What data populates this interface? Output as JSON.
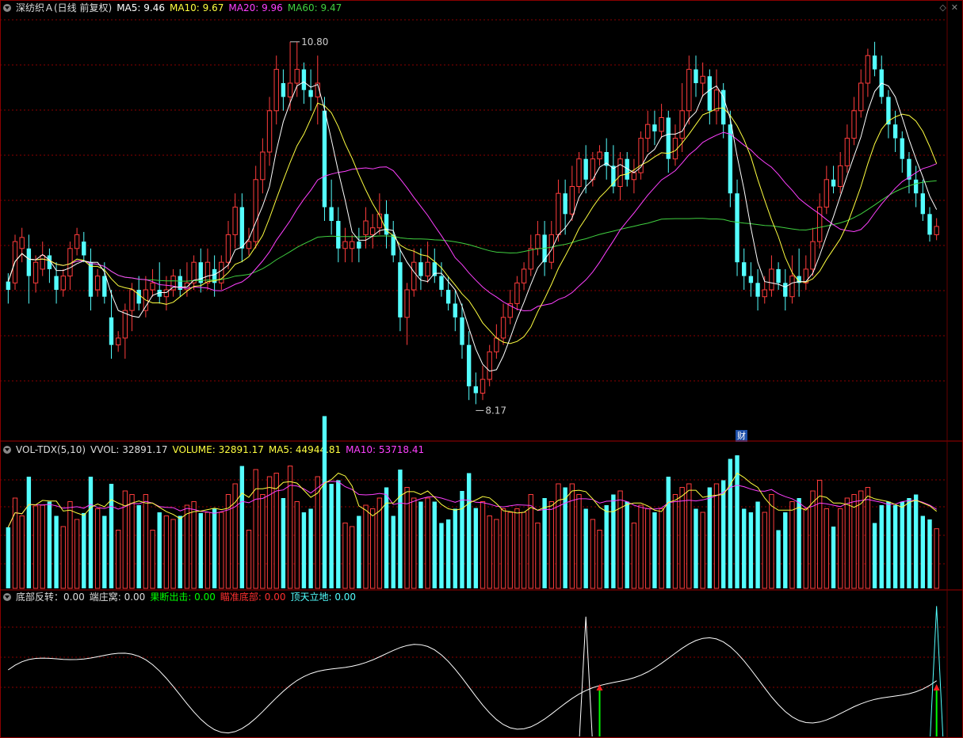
{
  "header_main": {
    "title": "深纺织Ａ(日线 前复权)",
    "ma5": "MA5: 9.46",
    "ma10": "MA10: 9.67",
    "ma20": "MA20: 9.96",
    "ma60": "MA60: 9.47"
  },
  "header_vol": {
    "name": "VOL-TDX(5,10)",
    "vvol": "VVOL: 32891.17",
    "volume": "VOLUME: 32891.17",
    "ma5": "MA5: 44944.81",
    "ma10": "MA10: 53718.41"
  },
  "header_ind": {
    "a": "底部反转：0.00",
    "b": "端庄窝: 0.00",
    "c": "果断出击: 0.00",
    "d": "瞄准底部: 0.00",
    "e": "顶天立地: 0.00"
  },
  "marker_high": "10.80",
  "marker_low": "8.17",
  "event_tag": "财",
  "colors": {
    "up": "#ff3c3c",
    "down": "#54ffff",
    "ma5": "#ffffff",
    "ma10": "#ffff40",
    "ma20": "#ff40ff",
    "ma60": "#40d040",
    "grid": "#8b0000",
    "green": "#00ff00",
    "red": "#ff2020"
  },
  "chart_data": {
    "type": "candlestick",
    "price_range": [
      8.0,
      11.0
    ],
    "volume_range": [
      0,
      110000
    ],
    "candles": [
      [
        9.0,
        9.06,
        9.12,
        8.9,
        "d"
      ],
      [
        9.05,
        9.35,
        9.4,
        9.0,
        "u"
      ],
      [
        9.3,
        9.38,
        9.45,
        9.2,
        "u"
      ],
      [
        9.3,
        9.1,
        9.4,
        8.9,
        "d"
      ],
      [
        9.05,
        9.2,
        9.25,
        8.98,
        "u"
      ],
      [
        9.15,
        9.25,
        9.35,
        9.1,
        "u"
      ],
      [
        9.25,
        9.15,
        9.3,
        9.05,
        "d"
      ],
      [
        9.1,
        9.0,
        9.2,
        8.9,
        "d"
      ],
      [
        9.0,
        9.1,
        9.15,
        8.95,
        "u"
      ],
      [
        9.1,
        9.3,
        9.35,
        9.0,
        "u"
      ],
      [
        9.3,
        9.4,
        9.45,
        9.25,
        "u"
      ],
      [
        9.35,
        9.25,
        9.42,
        9.2,
        "d"
      ],
      [
        9.2,
        8.95,
        9.3,
        8.85,
        "d"
      ],
      [
        9.0,
        9.1,
        9.15,
        8.95,
        "u"
      ],
      [
        9.1,
        8.95,
        9.2,
        8.9,
        "d"
      ],
      [
        8.8,
        8.6,
        9.0,
        8.5,
        "d"
      ],
      [
        8.6,
        8.65,
        8.7,
        8.55,
        "u"
      ],
      [
        8.65,
        8.85,
        8.9,
        8.5,
        "u"
      ],
      [
        8.85,
        9.0,
        9.05,
        8.7,
        "u"
      ],
      [
        9.0,
        8.9,
        9.1,
        8.85,
        "d"
      ],
      [
        8.85,
        9.0,
        9.1,
        8.8,
        "u"
      ],
      [
        9.0,
        9.05,
        9.15,
        8.95,
        "u"
      ],
      [
        9.0,
        8.95,
        9.2,
        8.9,
        "d"
      ],
      [
        8.95,
        9.0,
        9.1,
        8.85,
        "u"
      ],
      [
        9.0,
        9.1,
        9.15,
        8.95,
        "u"
      ],
      [
        9.1,
        9.0,
        9.15,
        8.95,
        "d"
      ],
      [
        9.0,
        9.05,
        9.2,
        8.95,
        "u"
      ],
      [
        9.05,
        9.2,
        9.25,
        9.0,
        "u"
      ],
      [
        9.2,
        9.05,
        9.3,
        8.98,
        "d"
      ],
      [
        9.05,
        9.2,
        9.3,
        9.0,
        "u"
      ],
      [
        9.15,
        9.05,
        9.25,
        8.95,
        "d"
      ],
      [
        9.05,
        9.2,
        9.25,
        9.0,
        "u"
      ],
      [
        9.2,
        9.4,
        9.5,
        9.15,
        "u"
      ],
      [
        9.4,
        9.6,
        9.7,
        9.3,
        "u"
      ],
      [
        9.6,
        9.3,
        9.7,
        9.2,
        "d"
      ],
      [
        9.3,
        9.35,
        9.45,
        9.25,
        "u"
      ],
      [
        9.35,
        9.8,
        9.9,
        9.3,
        "u"
      ],
      [
        9.8,
        10.0,
        10.1,
        9.7,
        "u"
      ],
      [
        10.0,
        10.3,
        10.4,
        9.9,
        "u"
      ],
      [
        10.3,
        10.6,
        10.7,
        10.2,
        "u"
      ],
      [
        10.5,
        10.4,
        10.6,
        10.3,
        "d"
      ],
      [
        10.4,
        10.5,
        10.8,
        10.3,
        "u"
      ],
      [
        10.5,
        10.6,
        10.8,
        10.4,
        "u"
      ],
      [
        10.6,
        10.45,
        10.65,
        10.35,
        "d"
      ],
      [
        10.45,
        10.4,
        10.6,
        10.3,
        "d"
      ],
      [
        10.4,
        10.5,
        10.7,
        10.2,
        "u"
      ],
      [
        10.3,
        9.6,
        10.4,
        9.5,
        "d"
      ],
      [
        9.6,
        9.5,
        9.8,
        9.4,
        "d"
      ],
      [
        9.5,
        9.3,
        9.6,
        9.2,
        "d"
      ],
      [
        9.3,
        9.35,
        9.45,
        9.2,
        "u"
      ],
      [
        9.3,
        9.35,
        9.4,
        9.2,
        "u"
      ],
      [
        9.35,
        9.3,
        9.45,
        9.2,
        "d"
      ],
      [
        9.4,
        9.5,
        9.6,
        9.3,
        "u"
      ],
      [
        9.4,
        9.45,
        9.55,
        9.3,
        "u"
      ],
      [
        9.45,
        9.55,
        9.7,
        9.4,
        "u"
      ],
      [
        9.55,
        9.4,
        9.65,
        9.3,
        "d"
      ],
      [
        9.4,
        9.25,
        9.5,
        9.2,
        "d"
      ],
      [
        9.2,
        8.8,
        9.3,
        8.7,
        "d"
      ],
      [
        8.8,
        9.0,
        9.05,
        8.6,
        "u"
      ],
      [
        9.0,
        9.2,
        9.3,
        8.95,
        "u"
      ],
      [
        9.2,
        9.1,
        9.3,
        9.0,
        "d"
      ],
      [
        9.1,
        9.2,
        9.35,
        9.05,
        "u"
      ],
      [
        9.2,
        9.1,
        9.3,
        9.05,
        "d"
      ],
      [
        9.1,
        9.0,
        9.2,
        8.95,
        "d"
      ],
      [
        9.0,
        8.9,
        9.1,
        8.85,
        "d"
      ],
      [
        8.9,
        8.8,
        9.0,
        8.7,
        "d"
      ],
      [
        8.8,
        8.6,
        8.9,
        8.5,
        "d"
      ],
      [
        8.6,
        8.3,
        8.7,
        8.2,
        "d"
      ],
      [
        8.3,
        8.25,
        8.4,
        8.17,
        "d"
      ],
      [
        8.25,
        8.35,
        8.45,
        8.2,
        "u"
      ],
      [
        8.35,
        8.55,
        8.6,
        8.3,
        "u"
      ],
      [
        8.55,
        8.65,
        8.75,
        8.5,
        "u"
      ],
      [
        8.65,
        8.8,
        8.9,
        8.6,
        "u"
      ],
      [
        8.8,
        8.9,
        9.0,
        8.75,
        "u"
      ],
      [
        8.9,
        9.05,
        9.1,
        8.85,
        "u"
      ],
      [
        9.05,
        9.15,
        9.2,
        9.0,
        "u"
      ],
      [
        9.15,
        9.3,
        9.4,
        9.1,
        "u"
      ],
      [
        9.3,
        9.4,
        9.5,
        9.25,
        "u"
      ],
      [
        9.4,
        9.2,
        9.5,
        9.1,
        "d"
      ],
      [
        9.2,
        9.4,
        9.5,
        9.15,
        "u"
      ],
      [
        9.4,
        9.7,
        9.8,
        9.35,
        "u"
      ],
      [
        9.7,
        9.55,
        9.8,
        9.4,
        "d"
      ],
      [
        9.55,
        9.75,
        9.9,
        9.5,
        "u"
      ],
      [
        9.75,
        9.95,
        10.0,
        9.7,
        "u"
      ],
      [
        9.95,
        9.8,
        10.05,
        9.7,
        "d"
      ],
      [
        9.8,
        9.95,
        10.0,
        9.75,
        "u"
      ],
      [
        9.95,
        10.0,
        10.05,
        9.9,
        "u"
      ],
      [
        10.0,
        9.9,
        10.1,
        9.8,
        "d"
      ],
      [
        9.9,
        9.75,
        10.05,
        9.7,
        "d"
      ],
      [
        9.75,
        9.95,
        10.0,
        9.65,
        "u"
      ],
      [
        9.95,
        9.8,
        10.0,
        9.75,
        "d"
      ],
      [
        9.8,
        9.85,
        9.95,
        9.7,
        "u"
      ],
      [
        9.85,
        10.1,
        10.15,
        9.8,
        "u"
      ],
      [
        10.1,
        10.2,
        10.3,
        10.0,
        "u"
      ],
      [
        10.2,
        10.15,
        10.3,
        10.05,
        "d"
      ],
      [
        10.15,
        10.25,
        10.35,
        10.1,
        "u"
      ],
      [
        10.25,
        9.95,
        10.3,
        9.85,
        "d"
      ],
      [
        9.95,
        10.1,
        10.2,
        9.9,
        "u"
      ],
      [
        10.1,
        10.3,
        10.5,
        10.0,
        "u"
      ],
      [
        10.3,
        10.6,
        10.7,
        10.2,
        "u"
      ],
      [
        10.6,
        10.5,
        10.7,
        10.4,
        "d"
      ],
      [
        10.5,
        10.55,
        10.65,
        10.4,
        "u"
      ],
      [
        10.55,
        10.3,
        10.6,
        10.2,
        "d"
      ],
      [
        10.3,
        10.45,
        10.6,
        10.2,
        "u"
      ],
      [
        10.45,
        10.2,
        10.5,
        10.1,
        "d"
      ],
      [
        10.2,
        9.7,
        10.3,
        9.6,
        "d"
      ],
      [
        9.7,
        9.2,
        9.8,
        9.1,
        "d"
      ],
      [
        9.2,
        9.1,
        9.3,
        9.0,
        "d"
      ],
      [
        9.1,
        9.05,
        9.2,
        8.95,
        "d"
      ],
      [
        9.05,
        8.95,
        9.15,
        8.85,
        "d"
      ],
      [
        8.95,
        9.0,
        9.1,
        8.9,
        "u"
      ],
      [
        9.0,
        9.15,
        9.25,
        8.95,
        "u"
      ],
      [
        9.15,
        9.05,
        9.2,
        9.0,
        "d"
      ],
      [
        9.05,
        8.95,
        9.15,
        8.85,
        "d"
      ],
      [
        8.95,
        9.1,
        9.25,
        8.9,
        "u"
      ],
      [
        9.1,
        9.05,
        9.3,
        8.95,
        "d"
      ],
      [
        9.05,
        9.15,
        9.25,
        9.0,
        "u"
      ],
      [
        9.15,
        9.35,
        9.45,
        9.1,
        "u"
      ],
      [
        9.35,
        9.6,
        9.7,
        9.3,
        "u"
      ],
      [
        9.6,
        9.8,
        9.9,
        9.55,
        "u"
      ],
      [
        9.8,
        9.75,
        9.9,
        9.7,
        "d"
      ],
      [
        9.75,
        9.9,
        10.0,
        9.7,
        "u"
      ],
      [
        9.9,
        10.1,
        10.2,
        9.85,
        "u"
      ],
      [
        10.1,
        10.3,
        10.4,
        10.05,
        "u"
      ],
      [
        10.3,
        10.5,
        10.6,
        10.25,
        "u"
      ],
      [
        10.5,
        10.7,
        10.75,
        10.4,
        "u"
      ],
      [
        10.7,
        10.6,
        10.8,
        10.55,
        "d"
      ],
      [
        10.6,
        10.4,
        10.7,
        10.35,
        "d"
      ],
      [
        10.4,
        10.2,
        10.45,
        10.1,
        "d"
      ],
      [
        10.2,
        10.1,
        10.3,
        10.0,
        "d"
      ],
      [
        10.1,
        9.95,
        10.15,
        9.85,
        "d"
      ],
      [
        9.95,
        9.8,
        10.0,
        9.7,
        "d"
      ],
      [
        9.8,
        9.7,
        9.9,
        9.6,
        "d"
      ],
      [
        9.7,
        9.55,
        9.8,
        9.5,
        "d"
      ],
      [
        9.55,
        9.4,
        9.6,
        9.35,
        "d"
      ],
      [
        9.4,
        9.46,
        9.52,
        9.36,
        "u"
      ]
    ],
    "volumes": [],
    "indicator": {
      "max": 100
    }
  }
}
